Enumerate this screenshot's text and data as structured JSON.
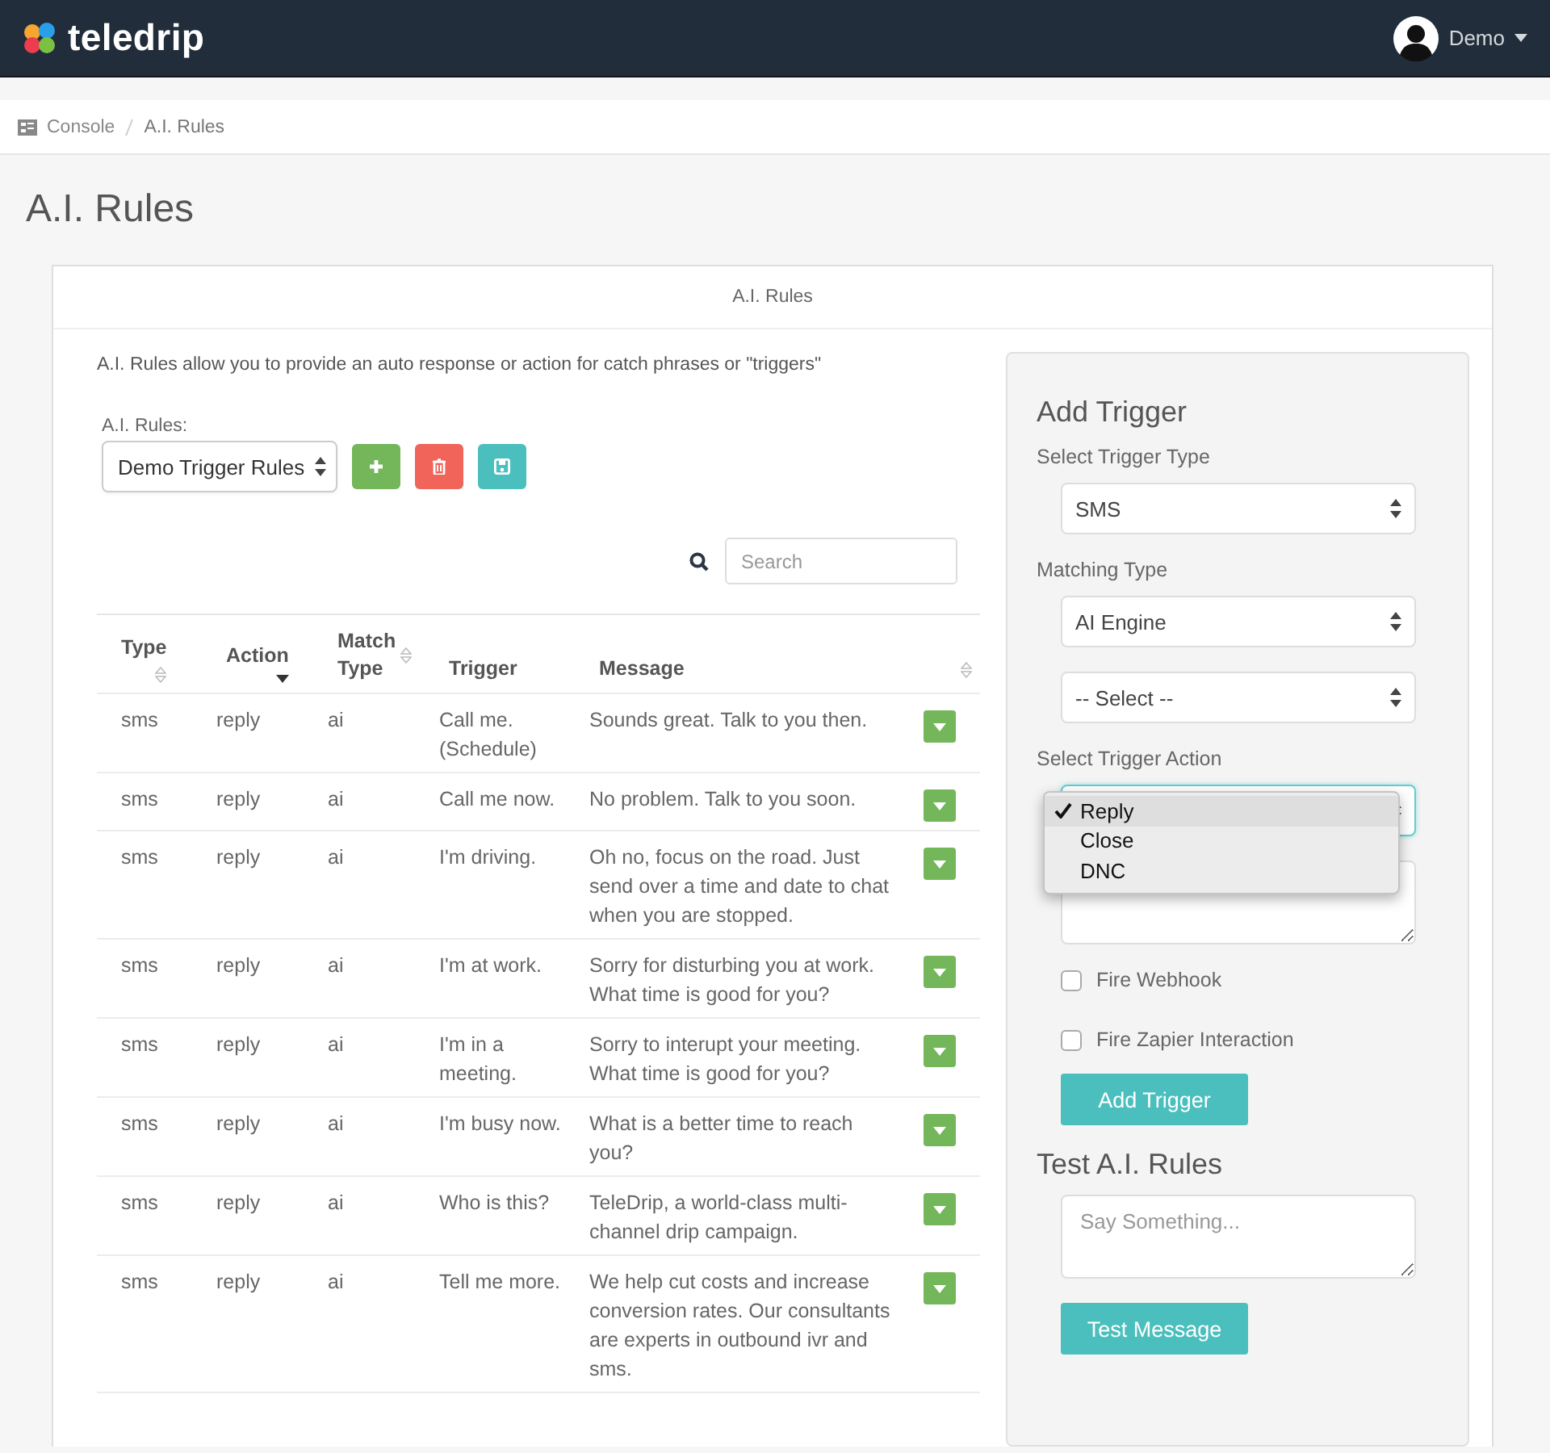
{
  "navbar": {
    "brand": "teledrip",
    "user": "Demo"
  },
  "breadcrumb": [
    "Console",
    "A.I. Rules"
  ],
  "page_title": "A.I. Rules",
  "panel": {
    "title": "A.I. Rules",
    "description": "A.I. Rules allow you to provide an auto response or action for catch phrases or \"triggers\"",
    "rule_set": {
      "label": "A.I. Rules:",
      "value": "Demo Trigger Rules"
    },
    "actions": [
      {
        "kind": "add"
      },
      {
        "kind": "delete"
      },
      {
        "kind": "save"
      }
    ],
    "search": {
      "placeholder": "Search"
    },
    "table": {
      "columns": [
        {
          "label": "Type",
          "sortable": true,
          "sorted": false
        },
        {
          "label": "Action",
          "sortable": true,
          "sorted": true
        },
        {
          "label": "Match Type",
          "sortable": true,
          "sorted": false
        },
        {
          "label": "Trigger",
          "sortable": false,
          "sorted": false
        },
        {
          "label": "Message",
          "sortable": false,
          "sorted": false
        },
        {
          "sortable": true,
          "sorted": false
        }
      ],
      "rows": [
        {
          "type": "sms",
          "action": "reply",
          "match_type": "ai",
          "trigger": "Call me. (Schedule)",
          "message": "Sounds great. Talk to you then."
        },
        {
          "type": "sms",
          "action": "reply",
          "match_type": "ai",
          "trigger": "Call me now.",
          "message": "No problem. Talk to you soon."
        },
        {
          "type": "sms",
          "action": "reply",
          "match_type": "ai",
          "trigger": "I'm driving.",
          "message": "Oh no, focus on the road. Just send over a time and date to chat when you are stopped."
        },
        {
          "type": "sms",
          "action": "reply",
          "match_type": "ai",
          "trigger": "I'm at work.",
          "message": "Sorry for disturbing you at work. What time is good for you?"
        },
        {
          "type": "sms",
          "action": "reply",
          "match_type": "ai",
          "trigger": "I'm in a meeting.",
          "message": "Sorry to interupt your meeting. What time is good for you?"
        },
        {
          "type": "sms",
          "action": "reply",
          "match_type": "ai",
          "trigger": "I'm busy now.",
          "message": "What is a better time to reach you?"
        },
        {
          "type": "sms",
          "action": "reply",
          "match_type": "ai",
          "trigger": "Who is this?",
          "message": "TeleDrip, a world-class multi-channel drip campaign."
        },
        {
          "type": "sms",
          "action": "reply",
          "match_type": "ai",
          "trigger": "Tell me more.",
          "message": "We help cut costs and increase conversion rates. Our consultants are experts in outbound ivr and sms."
        }
      ]
    }
  },
  "trigger_form": {
    "title": "Add Trigger",
    "fields": [
      {
        "kind": "select",
        "label": "Select Trigger Type",
        "value": "SMS",
        "focused": false
      },
      {
        "kind": "select",
        "label": "Matching Type",
        "value": "AI Engine",
        "focused": false
      },
      {
        "kind": "select",
        "value": "-- Select --",
        "focused": false
      },
      {
        "kind": "select",
        "label": "Select Trigger Action",
        "focused": true,
        "menu": [
          {
            "label": "Reply",
            "selected": true
          },
          {
            "label": "Close",
            "selected": false
          },
          {
            "label": "DNC",
            "selected": false
          }
        ]
      },
      {
        "kind": "textarea"
      },
      {
        "kind": "checkbox",
        "label": "Fire Webhook",
        "checked": false
      },
      {
        "kind": "checkbox",
        "label": "Fire Zapier Interaction",
        "checked": false
      }
    ],
    "submit": "Add Trigger"
  },
  "test": {
    "title": "Test A.I. Rules",
    "placeholder": "Say Something...",
    "button": "Test Message"
  }
}
